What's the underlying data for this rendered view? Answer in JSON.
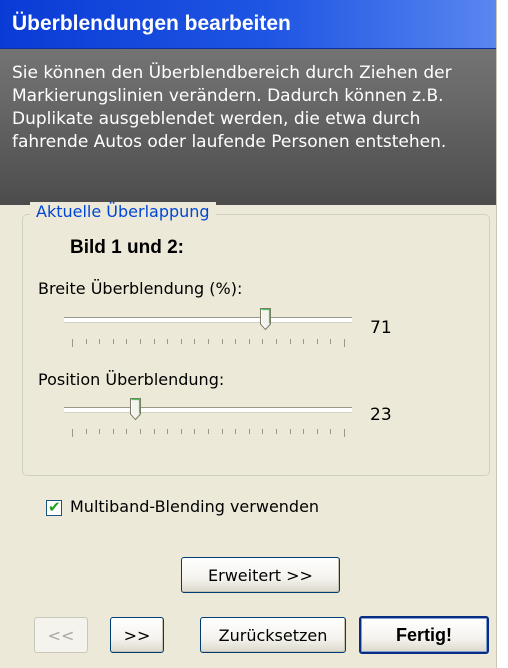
{
  "title": "Überblendungen bearbeiten",
  "description_lines": [
    "Sie können den Überblendbereich durch Ziehen der",
    "Markierungslinien verändern. Dadurch können z.B.",
    "Duplikate ausgeblendet werden, die etwa durch",
    "fahrende Autos oder laufende Personen entstehen."
  ],
  "group": {
    "legend": "Aktuelle Überlappung",
    "image_label": "Bild 1 und 2:",
    "width_label": "Breite Überblendung (%):",
    "width_value": "71",
    "width_fraction": 0.71,
    "position_label": "Position Überblendung:",
    "position_value": "23",
    "position_fraction": 0.23
  },
  "checkbox": {
    "label": "Multiband-Blending verwenden",
    "checked": true
  },
  "buttons": {
    "advanced": "Erweitert >>",
    "prev": "<<",
    "next": ">>",
    "reset": "Zurücksetzen",
    "finish": "Fertig!"
  },
  "colors": {
    "title_bar": "#1f56e3",
    "legend_text": "#0046d5",
    "checkmark": "#21a121"
  }
}
